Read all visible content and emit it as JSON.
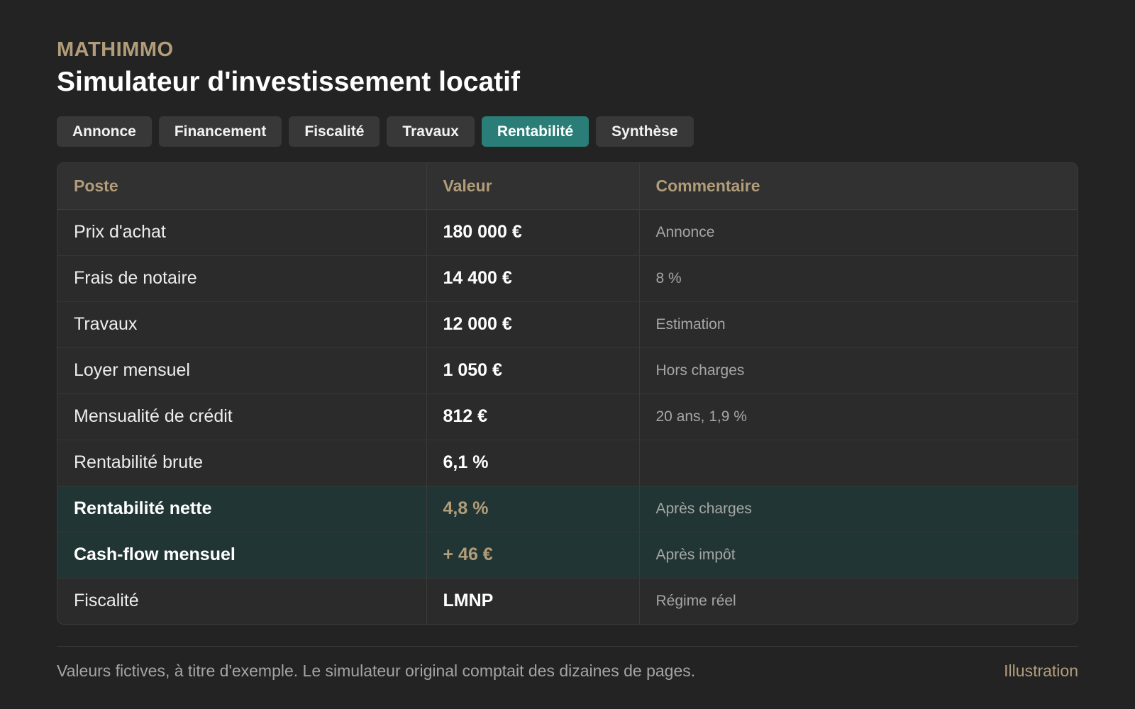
{
  "header": {
    "brand": "MATHIMMO",
    "title": "Simulateur d'investissement locatif"
  },
  "tabs": [
    {
      "label": "Annonce",
      "active": false
    },
    {
      "label": "Financement",
      "active": false
    },
    {
      "label": "Fiscalité",
      "active": false
    },
    {
      "label": "Travaux",
      "active": false
    },
    {
      "label": "Rentabilité",
      "active": true
    },
    {
      "label": "Synthèse",
      "active": false
    }
  ],
  "table": {
    "columns": [
      "Poste",
      "Valeur",
      "Commentaire"
    ],
    "rows": [
      {
        "poste": "Prix d'achat",
        "valeur": "180 000 €",
        "commentaire": "Annonce",
        "highlight": false
      },
      {
        "poste": "Frais de notaire",
        "valeur": "14 400 €",
        "commentaire": "8 %",
        "highlight": false
      },
      {
        "poste": "Travaux",
        "valeur": "12 000 €",
        "commentaire": "Estimation",
        "highlight": false
      },
      {
        "poste": "Loyer mensuel",
        "valeur": "1 050 €",
        "commentaire": "Hors charges",
        "highlight": false
      },
      {
        "poste": "Mensualité de crédit",
        "valeur": "812 €",
        "commentaire": "20 ans, 1,9 %",
        "highlight": false
      },
      {
        "poste": "Rentabilité brute",
        "valeur": "6,1 %",
        "commentaire": "",
        "highlight": false
      },
      {
        "poste": "Rentabilité nette",
        "valeur": "4,8 %",
        "commentaire": "Après charges",
        "highlight": true
      },
      {
        "poste": "Cash-flow mensuel",
        "valeur": "+ 46 €",
        "commentaire": "Après impôt",
        "highlight": true
      },
      {
        "poste": "Fiscalité",
        "valeur": "LMNP",
        "commentaire": "Régime réel",
        "highlight": false
      }
    ]
  },
  "footer": {
    "note": "Valeurs fictives, à titre d'exemple. Le simulateur original comptait des dizaines de pages.",
    "tag": "Illustration"
  },
  "colors": {
    "background": "#232323",
    "accent_gold": "#b29d7a",
    "active_tab": "#2a7e77",
    "highlight_row": "#213634"
  }
}
